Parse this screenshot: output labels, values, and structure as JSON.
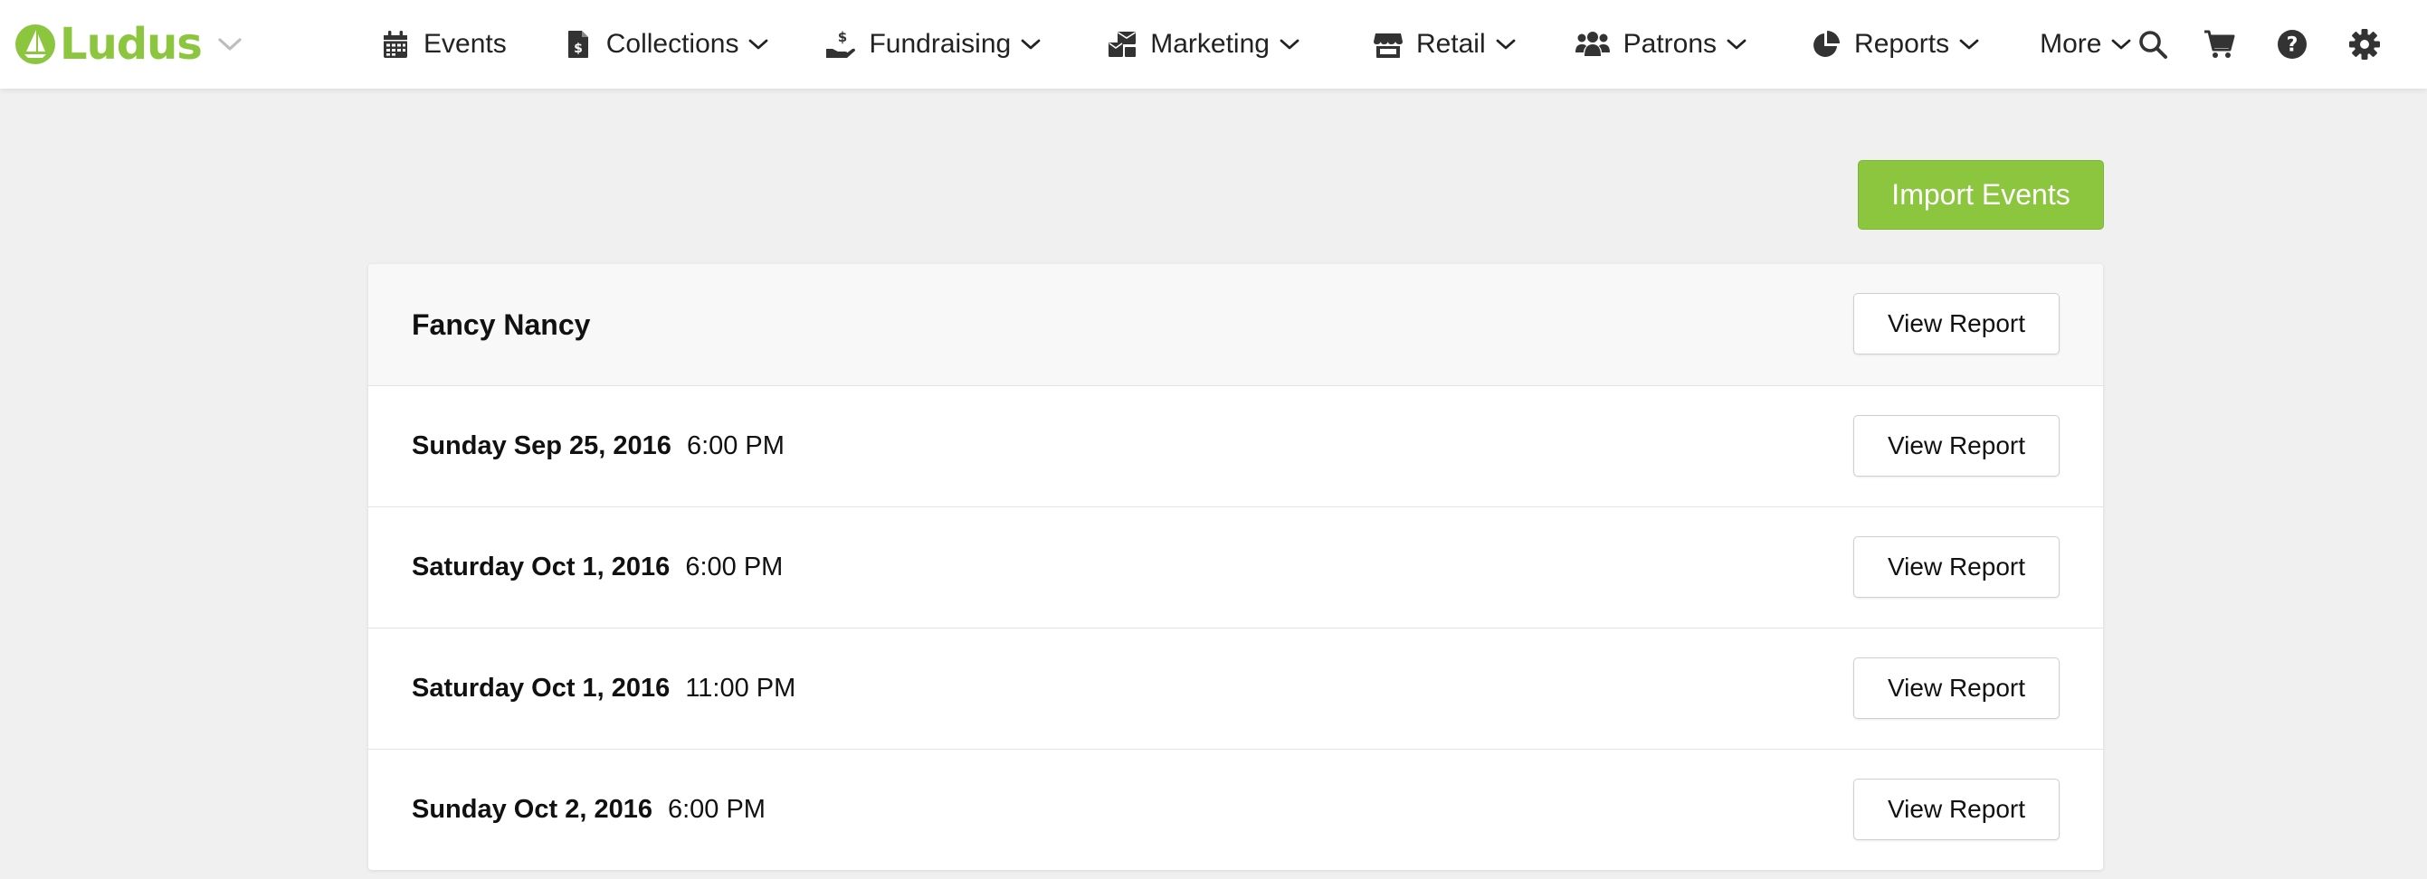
{
  "colors": {
    "brand_green": "#8cc63f",
    "nav_text": "#222222",
    "chevron_gray": "#bdbdbd",
    "page_bg": "#f0f0f0"
  },
  "brand": {
    "name": "Ludus",
    "logo_icon": "ludus-sail-icon",
    "switcher_icon": "chevron-down-icon"
  },
  "nav": {
    "items": [
      {
        "label": "Events",
        "icon": "calendar-icon",
        "has_dropdown": false
      },
      {
        "label": "Collections",
        "icon": "invoice-dollar-icon",
        "has_dropdown": true
      },
      {
        "label": "Fundraising",
        "icon": "hand-holding-dollar-icon",
        "has_dropdown": true
      },
      {
        "label": "Marketing",
        "icon": "mail-bulk-icon",
        "has_dropdown": true
      },
      {
        "label": "Retail",
        "icon": "store-icon",
        "has_dropdown": true
      },
      {
        "label": "Patrons",
        "icon": "users-icon",
        "has_dropdown": true
      },
      {
        "label": "Reports",
        "icon": "chart-pie-icon",
        "has_dropdown": true
      },
      {
        "label": "More",
        "icon": null,
        "has_dropdown": true
      }
    ]
  },
  "utilities": [
    {
      "name": "search",
      "icon": "search-icon"
    },
    {
      "name": "cart",
      "icon": "shopping-cart-icon"
    },
    {
      "name": "help",
      "icon": "question-circle-icon"
    },
    {
      "name": "settings",
      "icon": "gear-icon"
    }
  ],
  "actions": {
    "import_events_label": "Import Events"
  },
  "event": {
    "title": "Fancy Nancy",
    "view_report_label": "View Report",
    "performances": [
      {
        "date": "Sunday Sep 25, 2016",
        "time": "6:00 PM",
        "view_report_label": "View Report"
      },
      {
        "date": "Saturday Oct 1, 2016",
        "time": "6:00 PM",
        "view_report_label": "View Report"
      },
      {
        "date": "Saturday Oct 1, 2016",
        "time": "11:00 PM",
        "view_report_label": "View Report"
      },
      {
        "date": "Sunday Oct 2, 2016",
        "time": "6:00 PM",
        "view_report_label": "View Report"
      }
    ]
  }
}
